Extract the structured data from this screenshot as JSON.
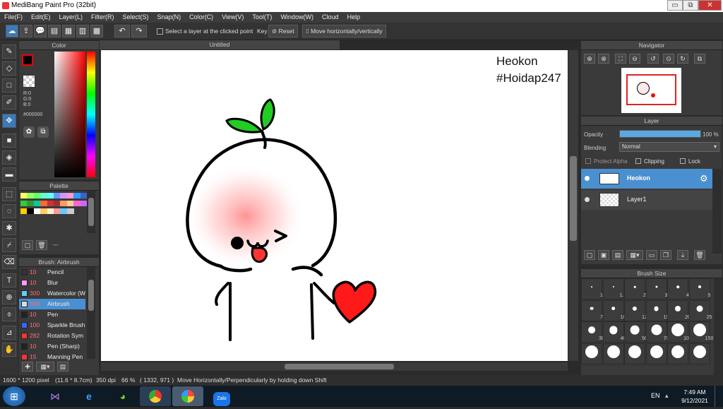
{
  "window": {
    "title": "MediBang Paint Pro (32bit)",
    "min": "▭",
    "restore": "⧉",
    "close": "✕"
  },
  "menu": [
    "File(F)",
    "Edit(E)",
    "Layer(L)",
    "Filter(R)",
    "Select(S)",
    "Snap(N)",
    "Color(C)",
    "View(V)",
    "Tool(T)",
    "Window(W)",
    "Cloud",
    "Help"
  ],
  "toolbar": {
    "select_layer_label": "Select a layer at the clicked point",
    "key_label": "Key",
    "reset_label": "Reset",
    "move_label": "Move horizontally/vertically"
  },
  "color_panel": {
    "title": "Color",
    "r": "R:0",
    "g": "G:0",
    "b": "B:0",
    "hex": "#000000"
  },
  "palette_panel": {
    "title": "Palette",
    "swatches": [
      "#ffff66",
      "#99ff66",
      "#66ff66",
      "#66ffcc",
      "#66ffff",
      "#6699ff",
      "#cc99ff",
      "#ff99cc",
      "#3399ff",
      "#3366cc",
      "#33cc33",
      "#339933",
      "#00cc99",
      "#ff6633",
      "#cc3333",
      "#993333",
      "#ff9966",
      "#ffcc99",
      "#ff66cc",
      "#cc66ff",
      "#ffcc00",
      "#000000",
      "#ffffff",
      "#ffcc66",
      "#ffeecc",
      "#ff9999",
      "#66ccff",
      "#cccccc"
    ],
    "footer": "---"
  },
  "brush_panel": {
    "title": "Brush: Airbrush",
    "items": [
      {
        "size": "10",
        "name": "Pencil",
        "color": "#333333"
      },
      {
        "size": "10",
        "name": "Blur",
        "color": "#ff99ff"
      },
      {
        "size": "300",
        "name": "Watercolor (W",
        "color": "#66ccff"
      },
      {
        "size": "300",
        "name": "Airbrush",
        "color": "#dddddd"
      },
      {
        "size": "10",
        "name": "Pen",
        "color": "#222222"
      },
      {
        "size": "100",
        "name": "Sparkle Brush",
        "color": "#3366ff"
      },
      {
        "size": "282",
        "name": "Rotation Sym",
        "color": "#ff3333"
      },
      {
        "size": "10",
        "name": "Pen (Sharp)",
        "color": "#222222"
      },
      {
        "size": "15",
        "name": "Manning Pen",
        "color": "#ff3333"
      }
    ]
  },
  "canvas": {
    "tab_title": "Untitled",
    "text_line1": "Heokon",
    "text_line2": "#Hoidap247"
  },
  "navigator": {
    "title": "Navigator"
  },
  "layer_panel": {
    "title": "Layer",
    "opacity_label": "Opacity",
    "opacity_value": "100 %",
    "opacity_fraction": 1.0,
    "blending_label": "Blending",
    "blending_value": "Normal",
    "protect_alpha": "Protect Alpha",
    "clipping": "Clipping",
    "lock": "Lock",
    "layers": [
      {
        "name": "Heokon",
        "selected": true
      },
      {
        "name": "Layer1",
        "selected": false
      }
    ]
  },
  "brush_size_panel": {
    "title": "Brush Size",
    "sizes": [
      "1",
      "1.5",
      "2",
      "3",
      "4",
      "5",
      "7",
      "10",
      "12",
      "15",
      "20",
      "25",
      "30",
      "40",
      "50",
      "70",
      "100",
      "150"
    ]
  },
  "status": {
    "dims": "1600 * 1200 pixel",
    "phys": "(11.6 * 8.7cm)",
    "dpi": "350 dpi",
    "zoom": "66 %",
    "coords": "( 1332, 971 )",
    "hint": "Move Horizontally/Perpendicularly by holding down Shift"
  },
  "taskbar": {
    "lang": "EN",
    "time": "7:49 AM",
    "date": "9/12/2021",
    "zalo": "Zalo"
  },
  "colors": {
    "accent": "#4a8fd0",
    "heart": "#ff1a1a",
    "leaf": "#22cc22",
    "blush": "#ff9999"
  }
}
